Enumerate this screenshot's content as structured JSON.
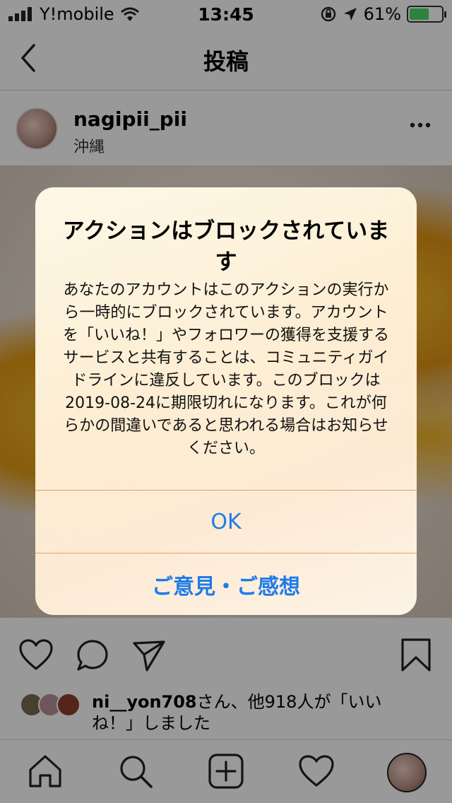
{
  "status_bar": {
    "carrier": "Y!mobile",
    "time": "13:45",
    "battery_percent": "61%",
    "battery_level": 0.61,
    "battery_color": "#4cd964"
  },
  "nav": {
    "title": "投稿",
    "back_icon": "chevron-left-icon"
  },
  "post": {
    "username": "nagipii_pii",
    "location": "沖縄",
    "more_icon": "more-horizontal-icon"
  },
  "actions": {
    "like_icon": "heart-icon",
    "comment_icon": "comment-icon",
    "share_icon": "send-icon",
    "save_icon": "bookmark-icon"
  },
  "likes": {
    "name": "ni__yon708",
    "text": "さん、他918人が「いいね！」しました"
  },
  "tab_bar": {
    "items": [
      "home-icon",
      "search-icon",
      "add-post-icon",
      "activity-heart-icon",
      "profile-avatar"
    ]
  },
  "alert": {
    "title": "アクションはブロックされています",
    "message": "あなたのアカウントはこのアクションの実行から一時的にブロックされています。アカウントを「いいね！」やフォロワーの獲得を支援するサービスと共有することは、コミュニティガイドラインに違反しています。このブロックは2019-08-24に期限切れになります。これが何らかの間違いであると思われる場合はお知らせください。",
    "ok_label": "OK",
    "feedback_label": "ご意見・ご感想"
  },
  "colors": {
    "accent": "#1e7bea",
    "divider": "#e0a36a"
  }
}
